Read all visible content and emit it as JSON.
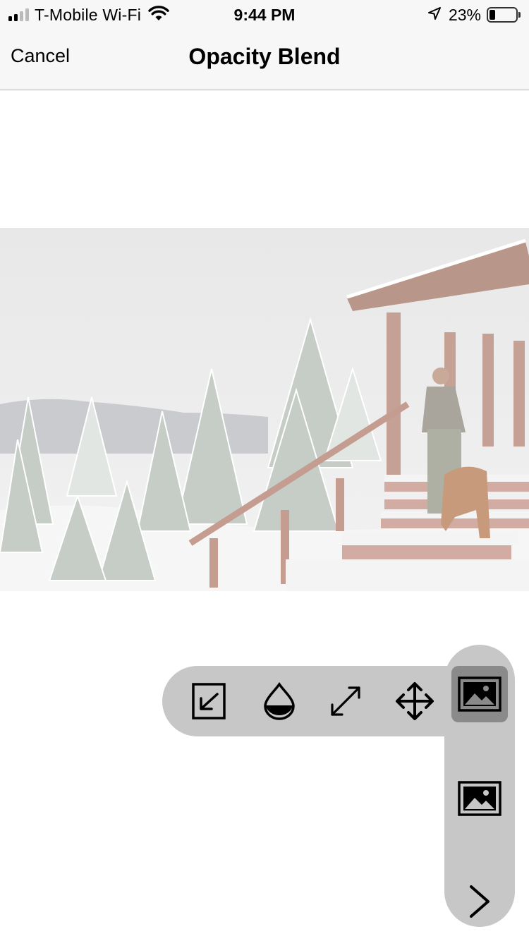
{
  "status_bar": {
    "carrier": "T-Mobile Wi-Fi",
    "time": "9:44 PM",
    "battery_percent": "23%",
    "battery_level": 0.23,
    "icons": [
      "signal-icon",
      "wifi-icon",
      "location-arrow-icon",
      "battery-icon"
    ]
  },
  "nav": {
    "cancel_label": "Cancel",
    "title": "Opacity Blend"
  },
  "toolbar": {
    "tools": [
      {
        "name": "insert-layer-tool",
        "icon": "arrow-into-box-icon"
      },
      {
        "name": "opacity-tool",
        "icon": "half-drop-icon"
      },
      {
        "name": "resize-tool",
        "icon": "diagonal-arrows-icon"
      },
      {
        "name": "move-tool",
        "icon": "four-way-arrows-icon"
      }
    ]
  },
  "layer_panel": {
    "items": [
      {
        "name": "top-layer",
        "icon": "image-icon",
        "selected": true
      },
      {
        "name": "bottom-layer",
        "icon": "image-icon",
        "selected": false
      },
      {
        "name": "next",
        "icon": "chevron-right-icon"
      }
    ]
  },
  "colors": {
    "bar_background": "#f7f7f7",
    "tool_panel": "#c7c7c7",
    "selected_tool": "#8a8a8a"
  }
}
